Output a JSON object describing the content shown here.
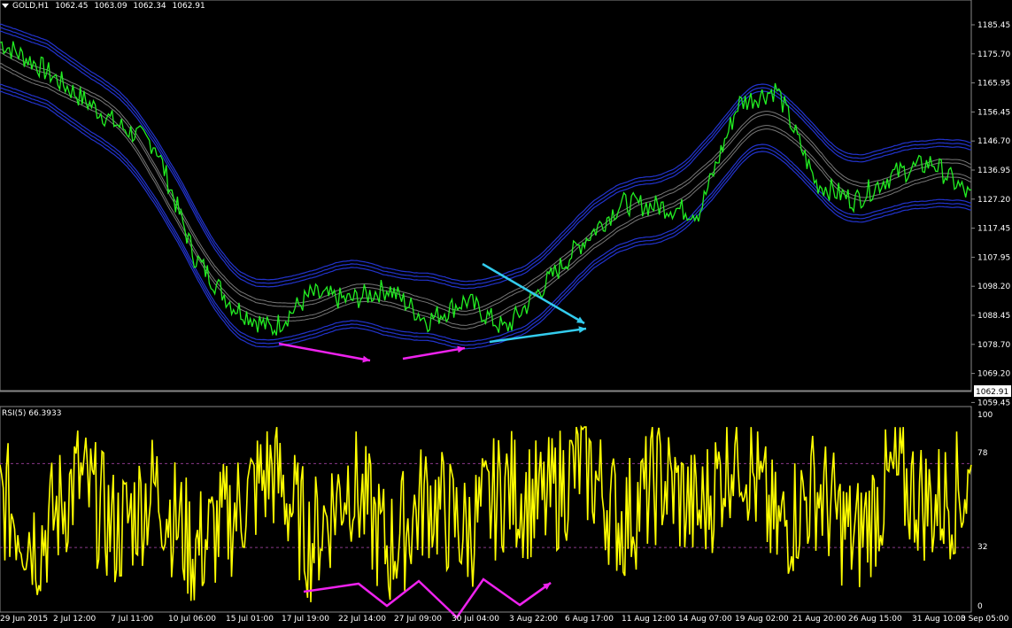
{
  "header": {
    "symbol": "GOLD,H1",
    "ohlc": [
      "1062.45",
      "1063.09",
      "1062.34",
      "1062.91"
    ]
  },
  "price_axis": {
    "labels": [
      "1185.45",
      "1175.70",
      "1165.95",
      "1156.45",
      "1146.70",
      "1136.95",
      "1127.20",
      "1117.45",
      "1107.95",
      "1098.20",
      "1088.45",
      "1078.70",
      "1069.20",
      "1059.45"
    ],
    "current_price": "1062.91"
  },
  "indicator": {
    "title": "RSI(5) 66.3933",
    "levels": [
      "100",
      "78",
      "32",
      "0"
    ]
  },
  "time_axis": {
    "labels": [
      "29 Jun 2015",
      "2 Jul 12:00",
      "7 Jul 11:00",
      "10 Jul 06:00",
      "15 Jul 01:00",
      "17 Jul 19:00",
      "22 Jul 14:00",
      "27 Jul 09:00",
      "30 Jul 04:00",
      "3 Aug 22:00",
      "6 Aug 17:00",
      "11 Aug 12:00",
      "14 Aug 07:00",
      "19 Aug 02:00",
      "21 Aug 20:00",
      "26 Aug 15:00",
      "31 Aug 10:00",
      "3 Sep 05:00"
    ]
  },
  "colors": {
    "background": "#000000",
    "price_line": "#22ee22",
    "bands_outer": "#2233cc",
    "bands_inner": "#777777",
    "rsi_line": "#ffff00",
    "rsi_level": "#8a3a8a",
    "annotation_magenta": "#ee22ee",
    "annotation_cyan": "#33ccee"
  },
  "chart_data": [
    {
      "type": "line",
      "title": "GOLD,H1",
      "y_range": [
        1059.45,
        1190
      ],
      "series": [
        {
          "name": "GOLD,H1",
          "x": [
            0,
            4,
            8,
            12,
            16,
            20,
            24,
            28,
            32,
            36,
            40,
            44,
            48,
            52,
            56,
            60,
            64,
            68,
            72,
            76,
            80,
            84,
            88,
            92,
            96,
            100
          ],
          "y": [
            1178,
            1170,
            1160,
            1150,
            1143,
            1105,
            1088,
            1080,
            1092,
            1090,
            1094,
            1083,
            1090,
            1080,
            1095,
            1110,
            1123,
            1122,
            1120,
            1157,
            1162,
            1130,
            1124,
            1133,
            1137,
            1125
          ]
        }
      ]
    },
    {
      "type": "line",
      "title": "RSI(5) 66.3933",
      "y_range": [
        0,
        100
      ],
      "reference_levels": [
        78,
        32
      ],
      "series": [
        {
          "name": "RSI(5)",
          "x": [
            0,
            4,
            8,
            12,
            16,
            20,
            24,
            28,
            32,
            36,
            40,
            44,
            48,
            52,
            56,
            60,
            64,
            68,
            72,
            76,
            80,
            84,
            88,
            92,
            96,
            100
          ],
          "y": [
            60,
            35,
            70,
            40,
            65,
            30,
            50,
            75,
            35,
            70,
            30,
            60,
            40,
            65,
            55,
            80,
            45,
            70,
            50,
            90,
            40,
            65,
            35,
            70,
            55,
            66
          ]
        }
      ]
    }
  ]
}
